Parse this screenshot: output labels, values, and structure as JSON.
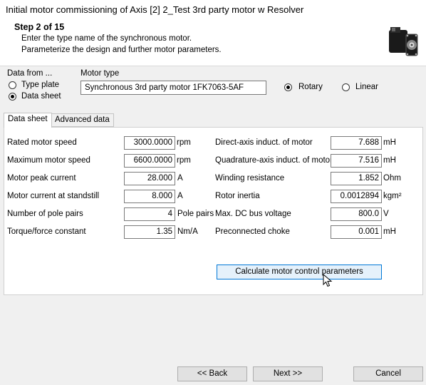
{
  "window": {
    "title": "Initial motor commissioning of Axis [2] 2_Test 3rd party motor w Resolver"
  },
  "header": {
    "step": "Step 2 of 15",
    "line1": "Enter the type name of the synchronous motor.",
    "line2": "Parameterize the design and further motor parameters."
  },
  "data_from": {
    "label": "Data from ...",
    "options": [
      {
        "label": "Type plate",
        "selected": false
      },
      {
        "label": "Data sheet",
        "selected": true
      }
    ]
  },
  "motor_type": {
    "label": "Motor type",
    "value": "Synchronous 3rd party motor 1FK7063-5AF",
    "rotary_label": "Rotary",
    "rotary_selected": true,
    "linear_label": "Linear",
    "linear_selected": false
  },
  "tabs": [
    {
      "label": "Data sheet",
      "active": true
    },
    {
      "label": "Advanced data",
      "active": false
    }
  ],
  "params_left": [
    {
      "label": "Rated motor speed",
      "value": "3000.0000",
      "unit": "rpm"
    },
    {
      "label": "Maximum motor speed",
      "value": "6600.0000",
      "unit": "rpm"
    },
    {
      "label": "Motor peak current",
      "value": "28.000",
      "unit": "A"
    },
    {
      "label": "Motor current at standstill",
      "value": "8.000",
      "unit": "A"
    },
    {
      "label": "Number of pole pairs",
      "value": "4",
      "unit": "Pole pairs"
    },
    {
      "label": "Torque/force constant",
      "value": "1.35",
      "unit": "Nm/A"
    }
  ],
  "params_right": [
    {
      "label": "Direct-axis induct. of motor",
      "value": "7.688",
      "unit": "mH"
    },
    {
      "label": "Quadrature-axis induct. of motor",
      "value": "7.516",
      "unit": "mH"
    },
    {
      "label": "Winding resistance",
      "value": "1.852",
      "unit": "Ohm"
    },
    {
      "label": "Rotor inertia",
      "value": "0.0012894",
      "unit": "kgm²"
    },
    {
      "label": "Max. DC bus voltage",
      "value": "800.0",
      "unit": "V"
    },
    {
      "label": "Preconnected choke",
      "value": "0.001",
      "unit": "mH"
    }
  ],
  "buttons": {
    "calculate": "Calculate motor control parameters",
    "back": "<< Back",
    "next": "Next >>",
    "cancel": "Cancel"
  },
  "icons": {
    "motor": "servo-motor-icon",
    "cursor": "mouse-pointer-icon"
  }
}
